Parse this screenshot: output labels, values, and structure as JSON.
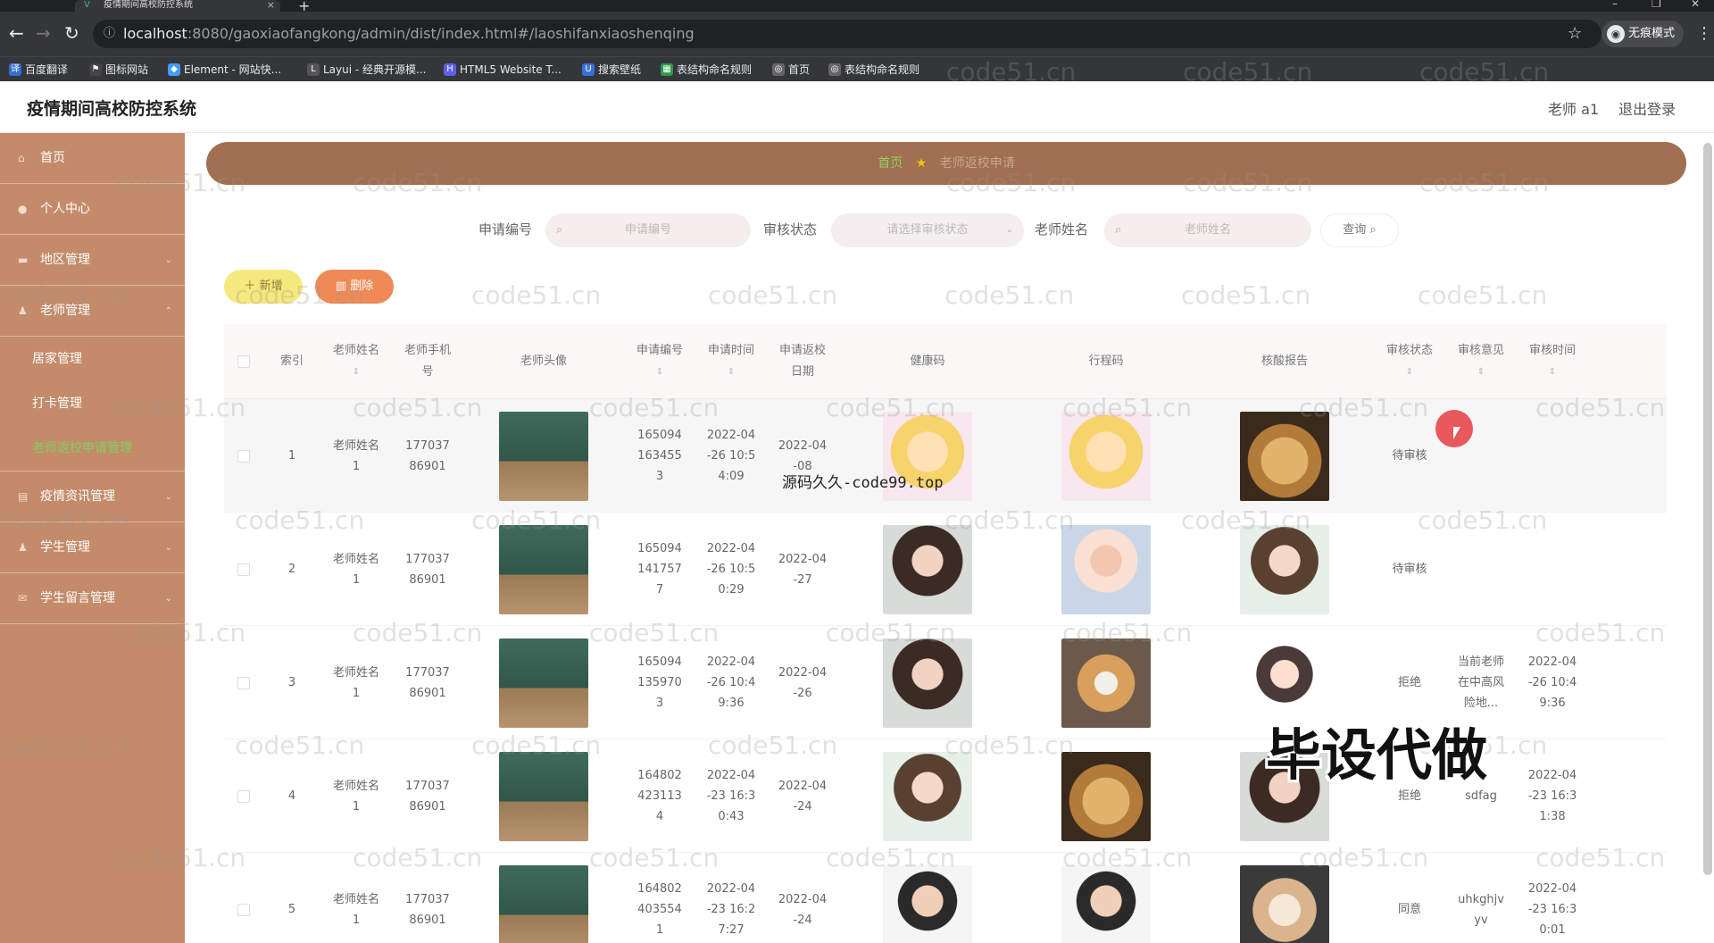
{
  "browser": {
    "tab_title": "疫情期间高校防控系统",
    "url_host": "localhost",
    "url_path": ":8080/gaoxiaofangkong/admin/dist/index.html#/laoshifanxiaoshenqing",
    "profile_label": "无痕模式",
    "bookmarks": [
      "百度翻译",
      "图标网站",
      "Element - 网站快...",
      "Layui - 经典开源模...",
      "HTML5 Website T...",
      "搜索壁纸",
      "表结构命名规则",
      "首页",
      "表结构命名规则"
    ]
  },
  "header": {
    "title": "疫情期间高校防控系统",
    "user": "老师 a1",
    "logout": "退出登录"
  },
  "sidebar": {
    "items": [
      {
        "label": "首页"
      },
      {
        "label": "个人中心"
      },
      {
        "label": "地区管理"
      },
      {
        "label": "老师管理"
      }
    ],
    "sub_items": [
      {
        "label": "居家管理"
      },
      {
        "label": "打卡管理"
      },
      {
        "label": "老师返校申请管理"
      }
    ],
    "items_after": [
      {
        "label": "疫情资讯管理"
      },
      {
        "label": "学生管理"
      },
      {
        "label": "学生留言管理"
      }
    ]
  },
  "breadcrumb": {
    "home": "首页",
    "current": "老师返校申请"
  },
  "search": {
    "code_label": "申请编号",
    "code_placeholder": "申请编号",
    "status_label": "审核状态",
    "status_placeholder": "请选择审核状态",
    "name_label": "老师姓名",
    "name_placeholder": "老师姓名",
    "query_button": "查询"
  },
  "actions": {
    "add": "新增",
    "delete": "删除"
  },
  "table": {
    "headers": {
      "index": "索引",
      "teacher_name": "老师姓名",
      "teacher_phone": "老师手机号",
      "avatar": "老师头像",
      "code": "申请编号",
      "apply_time": "申请时间",
      "return_date": "申请返校日期",
      "health_code": "健康码",
      "itinerary_code": "行程码",
      "nucleic": "核酸报告",
      "status": "审核状态",
      "opinion": "审核意见",
      "review_time": "审核时间"
    },
    "rows": [
      {
        "index": "1",
        "name": "老师姓名1",
        "phone": "17703786901",
        "code": "1650941634553",
        "apply_time": "2022-04-26 10:54:09",
        "return_date": "2022-04-08",
        "status": "待审核",
        "opinion": "",
        "review_time": ""
      },
      {
        "index": "2",
        "name": "老师姓名1",
        "phone": "17703786901",
        "code": "1650941417577",
        "apply_time": "2022-04-26 10:50:29",
        "return_date": "2022-04-27",
        "status": "待审核",
        "opinion": "",
        "review_time": ""
      },
      {
        "index": "3",
        "name": "老师姓名1",
        "phone": "17703786901",
        "code": "1650941359703",
        "apply_time": "2022-04-26 10:49:36",
        "return_date": "2022-04-26",
        "status": "拒绝",
        "opinion": "当前老师在中高风险地...",
        "review_time": "2022-04-26 10:49:36"
      },
      {
        "index": "4",
        "name": "老师姓名1",
        "phone": "17703786901",
        "code": "1648024231134",
        "apply_time": "2022-04-23 16:30:43",
        "return_date": "2022-04-24",
        "status": "拒绝",
        "opinion": "sdfag",
        "review_time": "2022-04-23 16:31:38"
      },
      {
        "index": "5",
        "name": "老师姓名1",
        "phone": "17703786901",
        "code": "1648024035541",
        "apply_time": "2022-04-23 16:27:27",
        "return_date": "2022-04-24",
        "status": "同意",
        "opinion": "uhkghjvyv",
        "review_time": "2022-04-23 16:30:01"
      }
    ]
  },
  "overlay": {
    "site_text": "源码久久-code99.top",
    "promo": "毕设代做",
    "watermark": "code51.cn"
  }
}
